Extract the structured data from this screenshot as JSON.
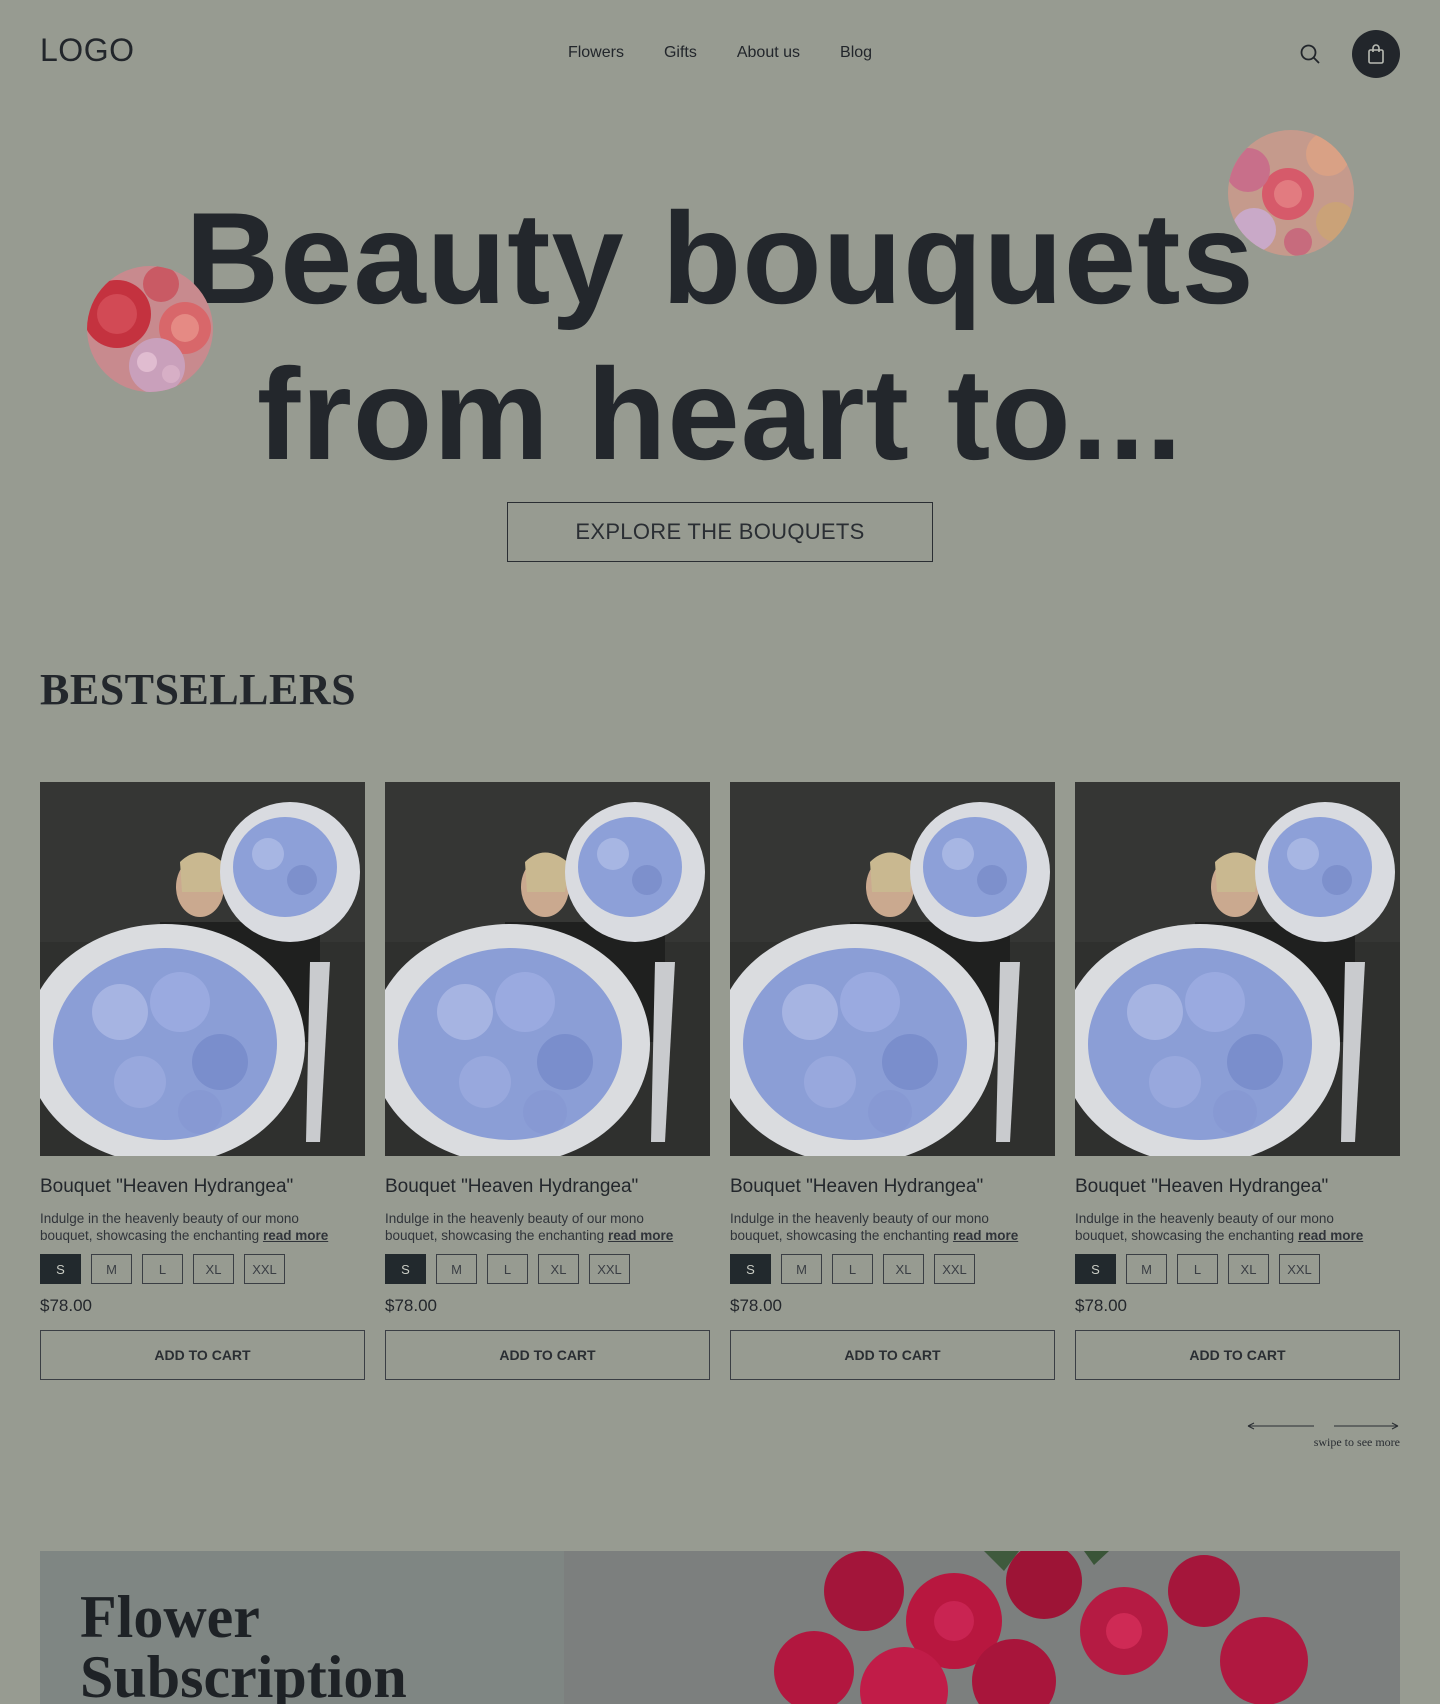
{
  "header": {
    "logo": "LOGO",
    "nav": [
      "Flowers",
      "Gifts",
      "About us",
      "Blog"
    ],
    "icons": {
      "search": "search-icon",
      "cart": "shopping-bag-icon"
    }
  },
  "hero": {
    "line1": "Beauty bouquets",
    "line2": "from heart to...",
    "cta": "EXPLORE THE BOUQUETS"
  },
  "bestsellers": {
    "title": "BESTSELLERS",
    "products": [
      {
        "title": "Bouquet \"Heaven Hydrangea\"",
        "desc_line1": "Indulge in the heavenly beauty of our mono",
        "desc_line2": "bouquet, showcasing the enchanting",
        "read_more": "read more",
        "sizes": [
          "S",
          "M",
          "L",
          "XL",
          "XXL"
        ],
        "selected_size": "S",
        "price": "$78.00",
        "add_to_cart": "ADD TO CART"
      },
      {
        "title": "Bouquet \"Heaven Hydrangea\"",
        "desc_line1": "Indulge in the heavenly beauty of our mono",
        "desc_line2": "bouquet, showcasing the enchanting",
        "read_more": "read more",
        "sizes": [
          "S",
          "M",
          "L",
          "XL",
          "XXL"
        ],
        "selected_size": "S",
        "price": "$78.00",
        "add_to_cart": "ADD TO CART"
      },
      {
        "title": "Bouquet \"Heaven Hydrangea\"",
        "desc_line1": "Indulge in the heavenly beauty of our mono",
        "desc_line2": "bouquet, showcasing the enchanting",
        "read_more": "read more",
        "sizes": [
          "S",
          "M",
          "L",
          "XL",
          "XXL"
        ],
        "selected_size": "S",
        "price": "$78.00",
        "add_to_cart": "ADD TO CART"
      },
      {
        "title": "Bouquet \"Heaven Hydrangea\"",
        "desc_line1": "Indulge in the heavenly beauty of our mono",
        "desc_line2": "bouquet, showcasing the enchanting",
        "read_more": "read more",
        "sizes": [
          "S",
          "M",
          "L",
          "XL",
          "XXL"
        ],
        "selected_size": "S",
        "price": "$78.00",
        "add_to_cart": "ADD TO CART"
      }
    ],
    "swipe_hint": "swipe to see more"
  },
  "subscription": {
    "title_line1": "Flower",
    "title_line2": "Subscription"
  },
  "colors": {
    "background": "#979b91",
    "text": "#22262b",
    "cart_button": "#22262b",
    "selected_size": "#22292d",
    "hydrangea": "#8ea0d6",
    "roses": "#c41f3d"
  }
}
